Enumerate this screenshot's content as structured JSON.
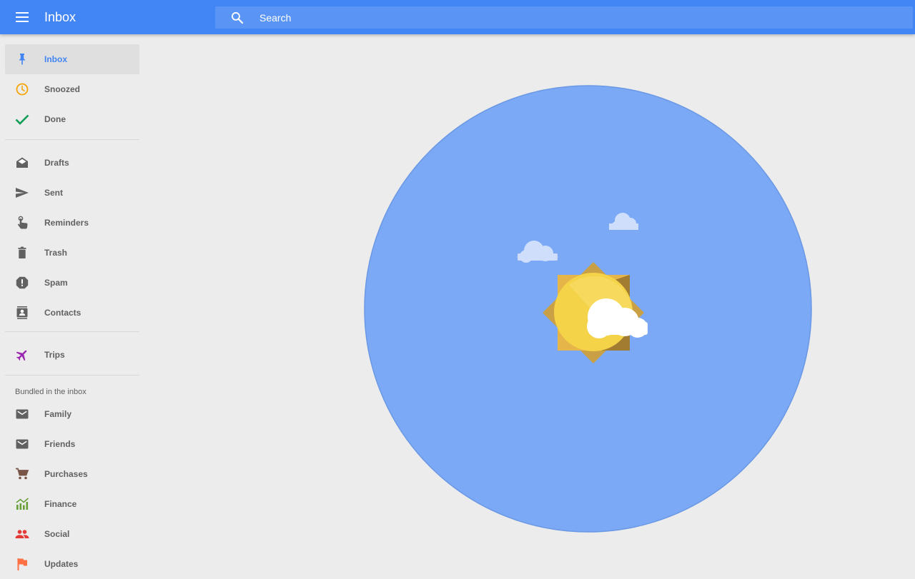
{
  "app": {
    "title": "Inbox"
  },
  "colors": {
    "topbar": "#4285f4",
    "accent": "#4285f4",
    "background": "#ececec",
    "circle": "#7ba9f6"
  },
  "search": {
    "placeholder": "Search",
    "icon": "search-icon"
  },
  "sidebar": {
    "primary": [
      {
        "label": "Inbox",
        "icon": "pin-icon",
        "active": true
      },
      {
        "label": "Snoozed",
        "icon": "clock-icon"
      },
      {
        "label": "Done",
        "icon": "check-icon"
      }
    ],
    "system": [
      {
        "label": "Drafts",
        "icon": "drafts-icon"
      },
      {
        "label": "Sent",
        "icon": "send-icon"
      },
      {
        "label": "Reminders",
        "icon": "reminder-hand-icon"
      },
      {
        "label": "Trash",
        "icon": "trash-icon"
      },
      {
        "label": "Spam",
        "icon": "spam-icon"
      },
      {
        "label": "Contacts",
        "icon": "contacts-icon"
      }
    ],
    "trips": [
      {
        "label": "Trips",
        "icon": "airplane-icon"
      }
    ],
    "bundles_title": "Bundled in the inbox",
    "bundles": [
      {
        "label": "Family",
        "icon": "mail-icon"
      },
      {
        "label": "Friends",
        "icon": "mail-icon"
      },
      {
        "label": "Purchases",
        "icon": "cart-icon"
      },
      {
        "label": "Finance",
        "icon": "finance-chart-icon"
      },
      {
        "label": "Social",
        "icon": "people-icon"
      },
      {
        "label": "Updates",
        "icon": "flag-icon"
      }
    ]
  },
  "main": {
    "illustration": "sun-and-clouds-illustration"
  }
}
